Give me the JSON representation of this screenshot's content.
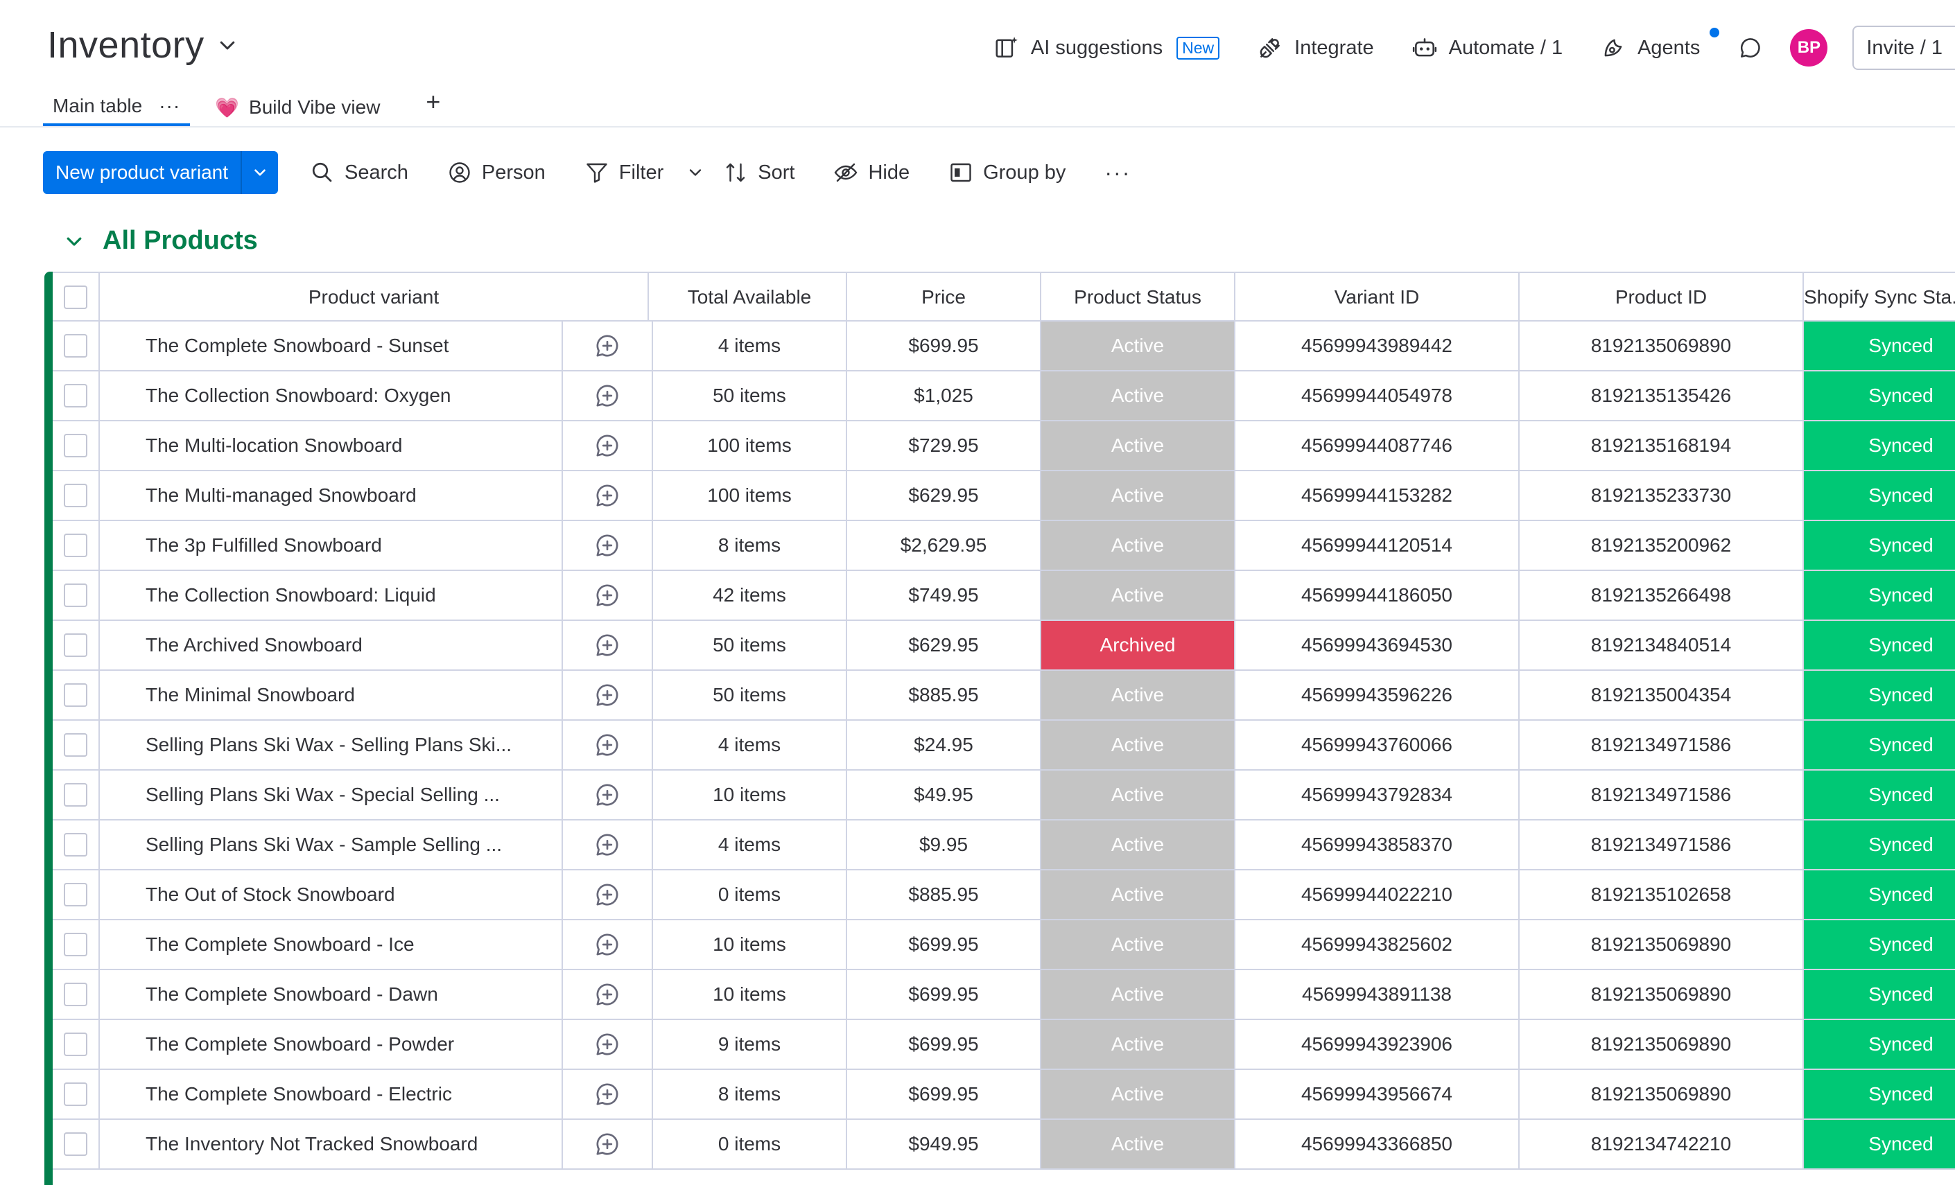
{
  "board": {
    "title": "Inventory"
  },
  "top_actions": {
    "ai_suggestions": "AI suggestions",
    "ai_badge": "New",
    "integrate": "Integrate",
    "automate": "Automate / 1",
    "agents": "Agents",
    "avatar_initials": "BP",
    "invite": "Invite / 1"
  },
  "tabs": [
    {
      "label": "Main table",
      "menu": "···"
    },
    {
      "label": "Build Vibe view",
      "emoji": "💗"
    }
  ],
  "tab_add": "+",
  "toolbar": {
    "new_item": "New product variant",
    "search": "Search",
    "person": "Person",
    "filter": "Filter",
    "sort": "Sort",
    "hide": "Hide",
    "group_by": "Group by",
    "more": "···"
  },
  "group": {
    "title": "All Products",
    "color": "#037f4c"
  },
  "columns": {
    "product_variant": "Product variant",
    "total_available": "Total Available",
    "price": "Price",
    "product_status": "Product Status",
    "variant_id": "Variant ID",
    "product_id": "Product ID",
    "shopify_sync": "Shopify Sync Sta..."
  },
  "status_colors": {
    "Active": "#c4c4c4",
    "Archived": "#e2445c",
    "Synced": "#00c875"
  },
  "rows": [
    {
      "name": "The Complete Snowboard - Sunset",
      "available": "4 items",
      "price": "$699.95",
      "status": "Active",
      "variant_id": "45699943989442",
      "product_id": "8192135069890",
      "sync": "Synced"
    },
    {
      "name": "The Collection Snowboard: Oxygen",
      "available": "50 items",
      "price": "$1,025",
      "status": "Active",
      "variant_id": "45699944054978",
      "product_id": "8192135135426",
      "sync": "Synced"
    },
    {
      "name": "The Multi-location Snowboard",
      "available": "100 items",
      "price": "$729.95",
      "status": "Active",
      "variant_id": "45699944087746",
      "product_id": "8192135168194",
      "sync": "Synced"
    },
    {
      "name": "The Multi-managed Snowboard",
      "available": "100 items",
      "price": "$629.95",
      "status": "Active",
      "variant_id": "45699944153282",
      "product_id": "8192135233730",
      "sync": "Synced"
    },
    {
      "name": "The 3p Fulfilled Snowboard",
      "available": "8 items",
      "price": "$2,629.95",
      "status": "Active",
      "variant_id": "45699944120514",
      "product_id": "8192135200962",
      "sync": "Synced"
    },
    {
      "name": "The Collection Snowboard: Liquid",
      "available": "42 items",
      "price": "$749.95",
      "status": "Active",
      "variant_id": "45699944186050",
      "product_id": "8192135266498",
      "sync": "Synced"
    },
    {
      "name": "The Archived Snowboard",
      "available": "50 items",
      "price": "$629.95",
      "status": "Archived",
      "variant_id": "45699943694530",
      "product_id": "8192134840514",
      "sync": "Synced"
    },
    {
      "name": "The Minimal Snowboard",
      "available": "50 items",
      "price": "$885.95",
      "status": "Active",
      "variant_id": "45699943596226",
      "product_id": "8192135004354",
      "sync": "Synced"
    },
    {
      "name": "Selling Plans Ski Wax - Selling Plans Ski...",
      "available": "4 items",
      "price": "$24.95",
      "status": "Active",
      "variant_id": "45699943760066",
      "product_id": "8192134971586",
      "sync": "Synced"
    },
    {
      "name": "Selling Plans Ski Wax - Special Selling ...",
      "available": "10 items",
      "price": "$49.95",
      "status": "Active",
      "variant_id": "45699943792834",
      "product_id": "8192134971586",
      "sync": "Synced"
    },
    {
      "name": "Selling Plans Ski Wax - Sample Selling ...",
      "available": "4 items",
      "price": "$9.95",
      "status": "Active",
      "variant_id": "45699943858370",
      "product_id": "8192134971586",
      "sync": "Synced"
    },
    {
      "name": "The Out of Stock Snowboard",
      "available": "0 items",
      "price": "$885.95",
      "status": "Active",
      "variant_id": "45699944022210",
      "product_id": "8192135102658",
      "sync": "Synced"
    },
    {
      "name": "The Complete Snowboard - Ice",
      "available": "10 items",
      "price": "$699.95",
      "status": "Active",
      "variant_id": "45699943825602",
      "product_id": "8192135069890",
      "sync": "Synced"
    },
    {
      "name": "The Complete Snowboard - Dawn",
      "available": "10 items",
      "price": "$699.95",
      "status": "Active",
      "variant_id": "45699943891138",
      "product_id": "8192135069890",
      "sync": "Synced"
    },
    {
      "name": "The Complete Snowboard - Powder",
      "available": "9 items",
      "price": "$699.95",
      "status": "Active",
      "variant_id": "45699943923906",
      "product_id": "8192135069890",
      "sync": "Synced"
    },
    {
      "name": "The Complete Snowboard - Electric",
      "available": "8 items",
      "price": "$699.95",
      "status": "Active",
      "variant_id": "45699943956674",
      "product_id": "8192135069890",
      "sync": "Synced"
    },
    {
      "name": "The Inventory Not Tracked Snowboard",
      "available": "0 items",
      "price": "$949.95",
      "status": "Active",
      "variant_id": "45699943366850",
      "product_id": "8192134742210",
      "sync": "Synced"
    }
  ]
}
